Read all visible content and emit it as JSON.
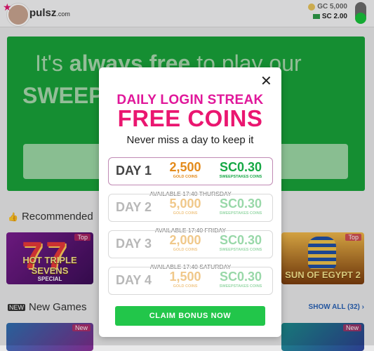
{
  "header": {
    "logo_text": "pulsz",
    "logo_suffix": ".com",
    "gc_balance": "GC 5,000",
    "sc_balance": "SC 2.00"
  },
  "hero": {
    "line1_prefix": "It's",
    "line1_bold": "always free",
    "line1_suffix": "to play our",
    "line2": "SWEEPSTAKES GAMES"
  },
  "sections": {
    "recommended": "Recommended",
    "new_games": "New Games",
    "show_all": "SHOW ALL (32) ›"
  },
  "tiles": {
    "hot_triple_sevens": {
      "name": "HOT TRIPLE SEVENS",
      "sub": "SPECIAL",
      "badge": "Top"
    },
    "sun_of_egypt": {
      "name": "SUN OF EGYPT 2",
      "badge": "Top"
    },
    "new_badge": "New"
  },
  "modal": {
    "title_line1": "DAILY LOGIN STREAK",
    "title_line2": "FREE COINS",
    "subtitle": "Never miss a day to keep it",
    "gold_label": "GOLD COINS",
    "sweep_label": "SWEEPSTAKES COINS",
    "days": [
      {
        "label": "DAY 1",
        "gold": "2,500",
        "sc": "SC0.30",
        "available": ""
      },
      {
        "label": "DAY 2",
        "gold": "5,000",
        "sc": "SC0.30",
        "available": "AVAILABLE 17:40 THURSDAY"
      },
      {
        "label": "DAY 3",
        "gold": "2,000",
        "sc": "SC0.30",
        "available": "AVAILABLE 17:40 FRIDAY"
      },
      {
        "label": "DAY 4",
        "gold": "1,500",
        "sc": "SC0.30",
        "available": "AVAILABLE 17:40 SATURDAY"
      }
    ],
    "claim_label": "CLAIM BONUS NOW"
  },
  "colors": {
    "accent_pink": "#ea1670",
    "gold": "#e38a1a",
    "sweeps_green": "#16a845",
    "claim_green": "#22c64a"
  }
}
